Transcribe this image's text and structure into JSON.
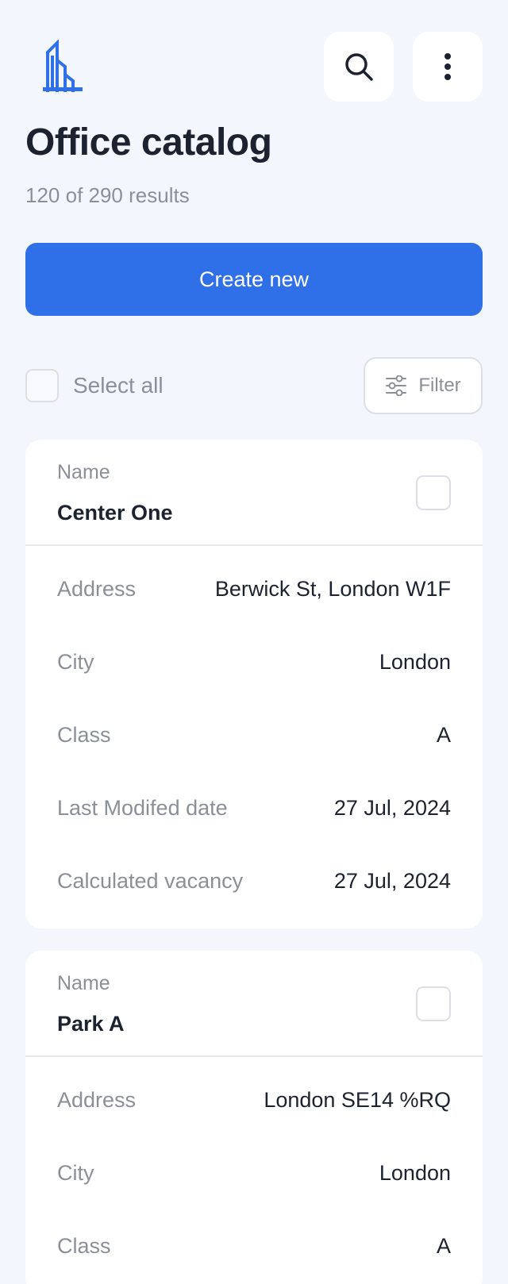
{
  "header": {
    "logo_icon": "building-logo-icon",
    "search_icon": "search-icon",
    "more_icon": "more-vertical-icon",
    "title": "Office catalog",
    "results": "120 of 290 results"
  },
  "actions": {
    "create_label": "Create new",
    "select_all_label": "Select all",
    "filter_label": "Filter",
    "filter_icon": "sliders-icon"
  },
  "colors": {
    "accent": "#2f6fe8",
    "background": "#f3f6fd",
    "muted_text": "#8b8f98"
  },
  "cards": [
    {
      "name_label": "Name",
      "name": "Center One",
      "fields": [
        {
          "label": "Address",
          "value": "Berwick St, London W1F"
        },
        {
          "label": "City",
          "value": "London"
        },
        {
          "label": "Class",
          "value": "A"
        },
        {
          "label": "Last Modifed date",
          "value": "27 Jul, 2024"
        },
        {
          "label": "Calculated vacancy",
          "value": "27 Jul, 2024"
        }
      ]
    },
    {
      "name_label": "Name",
      "name": "Park A",
      "fields": [
        {
          "label": "Address",
          "value": "London SE14 %RQ"
        },
        {
          "label": "City",
          "value": "London"
        },
        {
          "label": "Class",
          "value": "A"
        }
      ]
    }
  ]
}
